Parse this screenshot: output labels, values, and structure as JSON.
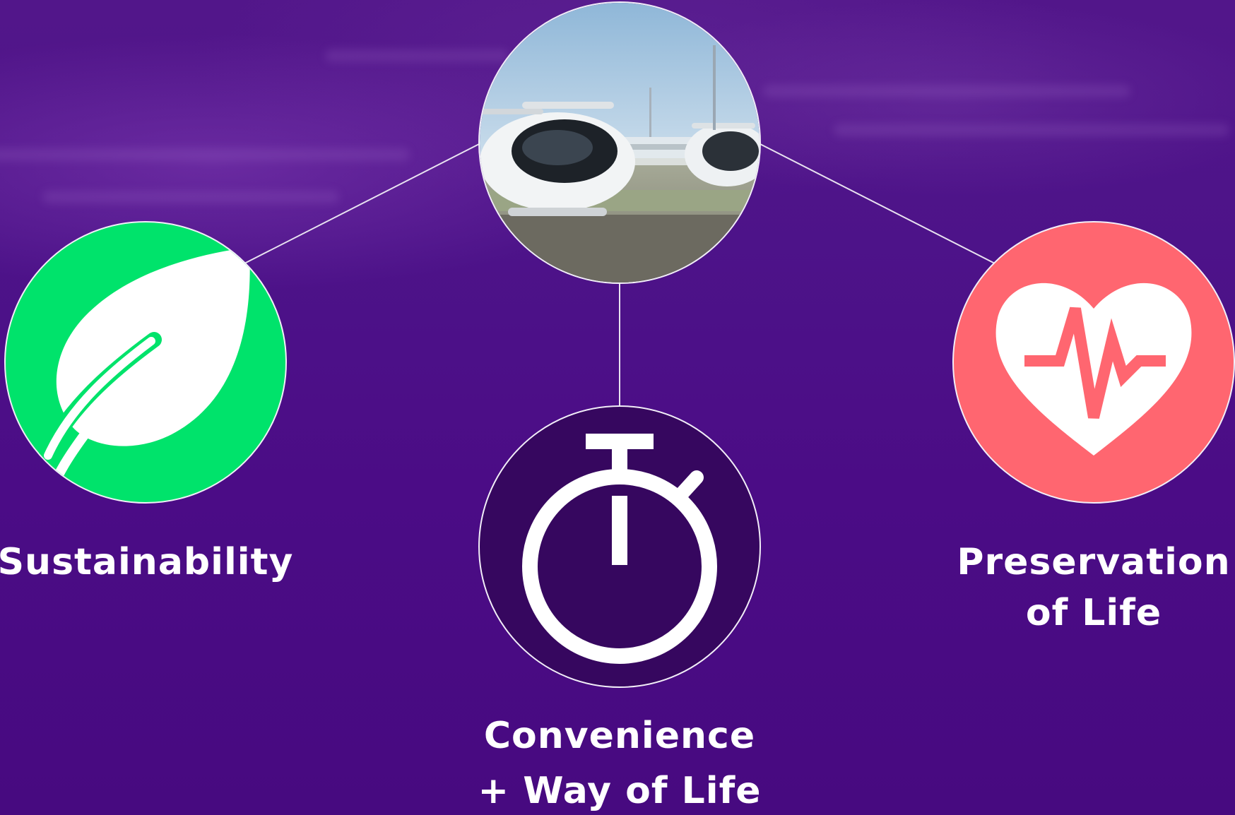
{
  "center_node": {
    "image": "flying-passenger-drone-photo"
  },
  "nodes": [
    {
      "id": "sustainability",
      "icon": "leaf-icon",
      "color": "#00e36b",
      "label_lines": [
        "Sustainability"
      ]
    },
    {
      "id": "convenience",
      "icon": "stopwatch-icon",
      "color": "#36075f",
      "label_lines": [
        "Convenience",
        "+ Way of Life"
      ]
    },
    {
      "id": "preservation",
      "icon": "heart-pulse-icon",
      "color": "#ff6670",
      "label_lines": [
        "Preservation",
        "of Life"
      ]
    }
  ],
  "colors": {
    "background": "#4b0c86",
    "connector": "#e8e2f0",
    "text": "#ffffff"
  }
}
